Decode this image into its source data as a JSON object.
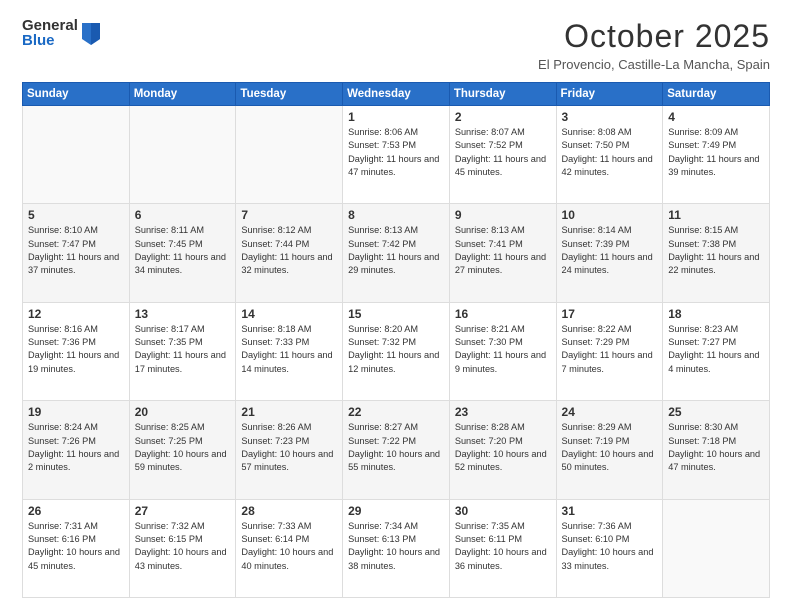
{
  "header": {
    "logo_general": "General",
    "logo_blue": "Blue",
    "month": "October 2025",
    "location": "El Provencio, Castille-La Mancha, Spain"
  },
  "days_of_week": [
    "Sunday",
    "Monday",
    "Tuesday",
    "Wednesday",
    "Thursday",
    "Friday",
    "Saturday"
  ],
  "weeks": [
    [
      {
        "day": "",
        "info": ""
      },
      {
        "day": "",
        "info": ""
      },
      {
        "day": "",
        "info": ""
      },
      {
        "day": "1",
        "info": "Sunrise: 8:06 AM\nSunset: 7:53 PM\nDaylight: 11 hours and 47 minutes."
      },
      {
        "day": "2",
        "info": "Sunrise: 8:07 AM\nSunset: 7:52 PM\nDaylight: 11 hours and 45 minutes."
      },
      {
        "day": "3",
        "info": "Sunrise: 8:08 AM\nSunset: 7:50 PM\nDaylight: 11 hours and 42 minutes."
      },
      {
        "day": "4",
        "info": "Sunrise: 8:09 AM\nSunset: 7:49 PM\nDaylight: 11 hours and 39 minutes."
      }
    ],
    [
      {
        "day": "5",
        "info": "Sunrise: 8:10 AM\nSunset: 7:47 PM\nDaylight: 11 hours and 37 minutes."
      },
      {
        "day": "6",
        "info": "Sunrise: 8:11 AM\nSunset: 7:45 PM\nDaylight: 11 hours and 34 minutes."
      },
      {
        "day": "7",
        "info": "Sunrise: 8:12 AM\nSunset: 7:44 PM\nDaylight: 11 hours and 32 minutes."
      },
      {
        "day": "8",
        "info": "Sunrise: 8:13 AM\nSunset: 7:42 PM\nDaylight: 11 hours and 29 minutes."
      },
      {
        "day": "9",
        "info": "Sunrise: 8:13 AM\nSunset: 7:41 PM\nDaylight: 11 hours and 27 minutes."
      },
      {
        "day": "10",
        "info": "Sunrise: 8:14 AM\nSunset: 7:39 PM\nDaylight: 11 hours and 24 minutes."
      },
      {
        "day": "11",
        "info": "Sunrise: 8:15 AM\nSunset: 7:38 PM\nDaylight: 11 hours and 22 minutes."
      }
    ],
    [
      {
        "day": "12",
        "info": "Sunrise: 8:16 AM\nSunset: 7:36 PM\nDaylight: 11 hours and 19 minutes."
      },
      {
        "day": "13",
        "info": "Sunrise: 8:17 AM\nSunset: 7:35 PM\nDaylight: 11 hours and 17 minutes."
      },
      {
        "day": "14",
        "info": "Sunrise: 8:18 AM\nSunset: 7:33 PM\nDaylight: 11 hours and 14 minutes."
      },
      {
        "day": "15",
        "info": "Sunrise: 8:20 AM\nSunset: 7:32 PM\nDaylight: 11 hours and 12 minutes."
      },
      {
        "day": "16",
        "info": "Sunrise: 8:21 AM\nSunset: 7:30 PM\nDaylight: 11 hours and 9 minutes."
      },
      {
        "day": "17",
        "info": "Sunrise: 8:22 AM\nSunset: 7:29 PM\nDaylight: 11 hours and 7 minutes."
      },
      {
        "day": "18",
        "info": "Sunrise: 8:23 AM\nSunset: 7:27 PM\nDaylight: 11 hours and 4 minutes."
      }
    ],
    [
      {
        "day": "19",
        "info": "Sunrise: 8:24 AM\nSunset: 7:26 PM\nDaylight: 11 hours and 2 minutes."
      },
      {
        "day": "20",
        "info": "Sunrise: 8:25 AM\nSunset: 7:25 PM\nDaylight: 10 hours and 59 minutes."
      },
      {
        "day": "21",
        "info": "Sunrise: 8:26 AM\nSunset: 7:23 PM\nDaylight: 10 hours and 57 minutes."
      },
      {
        "day": "22",
        "info": "Sunrise: 8:27 AM\nSunset: 7:22 PM\nDaylight: 10 hours and 55 minutes."
      },
      {
        "day": "23",
        "info": "Sunrise: 8:28 AM\nSunset: 7:20 PM\nDaylight: 10 hours and 52 minutes."
      },
      {
        "day": "24",
        "info": "Sunrise: 8:29 AM\nSunset: 7:19 PM\nDaylight: 10 hours and 50 minutes."
      },
      {
        "day": "25",
        "info": "Sunrise: 8:30 AM\nSunset: 7:18 PM\nDaylight: 10 hours and 47 minutes."
      }
    ],
    [
      {
        "day": "26",
        "info": "Sunrise: 7:31 AM\nSunset: 6:16 PM\nDaylight: 10 hours and 45 minutes."
      },
      {
        "day": "27",
        "info": "Sunrise: 7:32 AM\nSunset: 6:15 PM\nDaylight: 10 hours and 43 minutes."
      },
      {
        "day": "28",
        "info": "Sunrise: 7:33 AM\nSunset: 6:14 PM\nDaylight: 10 hours and 40 minutes."
      },
      {
        "day": "29",
        "info": "Sunrise: 7:34 AM\nSunset: 6:13 PM\nDaylight: 10 hours and 38 minutes."
      },
      {
        "day": "30",
        "info": "Sunrise: 7:35 AM\nSunset: 6:11 PM\nDaylight: 10 hours and 36 minutes."
      },
      {
        "day": "31",
        "info": "Sunrise: 7:36 AM\nSunset: 6:10 PM\nDaylight: 10 hours and 33 minutes."
      },
      {
        "day": "",
        "info": ""
      }
    ]
  ]
}
